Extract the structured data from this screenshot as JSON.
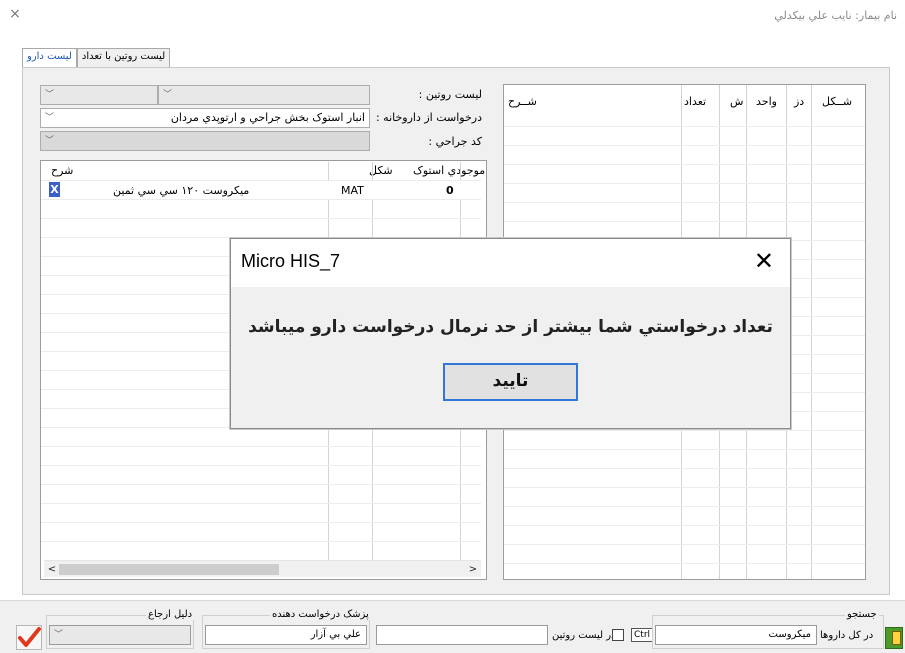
{
  "window": {
    "title": "نام بيمار: نايب علي  بيکدلي",
    "close": "×"
  },
  "tabs": [
    {
      "label": "ليست روتين با تعداد",
      "active": false
    },
    {
      "label": "ليست دارو",
      "active": true
    }
  ],
  "form": {
    "routine_list_label": "ليست روتين :",
    "request_from_label": "درخواست از داروخانه :",
    "request_from_value": "انبار استوک بخش جراحي و ارتوپدي مردان",
    "surgery_code_label": "کد جراحي :"
  },
  "left_grid": {
    "columns": [
      "موجودي استوک",
      "شکل",
      "شرح"
    ],
    "rows": [
      {
        "stock": "0",
        "shape": "MAT",
        "desc": "ميکروست ۱۲۰ سي سي ثمين",
        "remove": "X"
      }
    ]
  },
  "right_grid": {
    "columns": [
      "شــکل",
      "دز",
      "واحد",
      "ش",
      "تعداد",
      "شــرح"
    ]
  },
  "dialog": {
    "title": "Micro HIS_7",
    "close": "✕",
    "message": "تعداد درخواستي شما بيشتر از حد نرمال درخواست دارو ميباشد",
    "ok_label": "تاييد"
  },
  "footer": {
    "search_title": "جستجو",
    "all_drugs_label": "در کل داروها",
    "search_value": "ميکروست",
    "ctrl_label": "Ctrl",
    "routine_search_label": "در ليست روتين",
    "routine_search_value": "",
    "doctor_title": "پزشک درخواست دهنده",
    "doctor_value": "علي  بي آزار",
    "return_title": "دليل ارجاع",
    "return_value": ""
  },
  "colors": {
    "accent": "#3276d6",
    "tab_active_text": "#1c55b8",
    "check_red": "#e03a1e"
  }
}
